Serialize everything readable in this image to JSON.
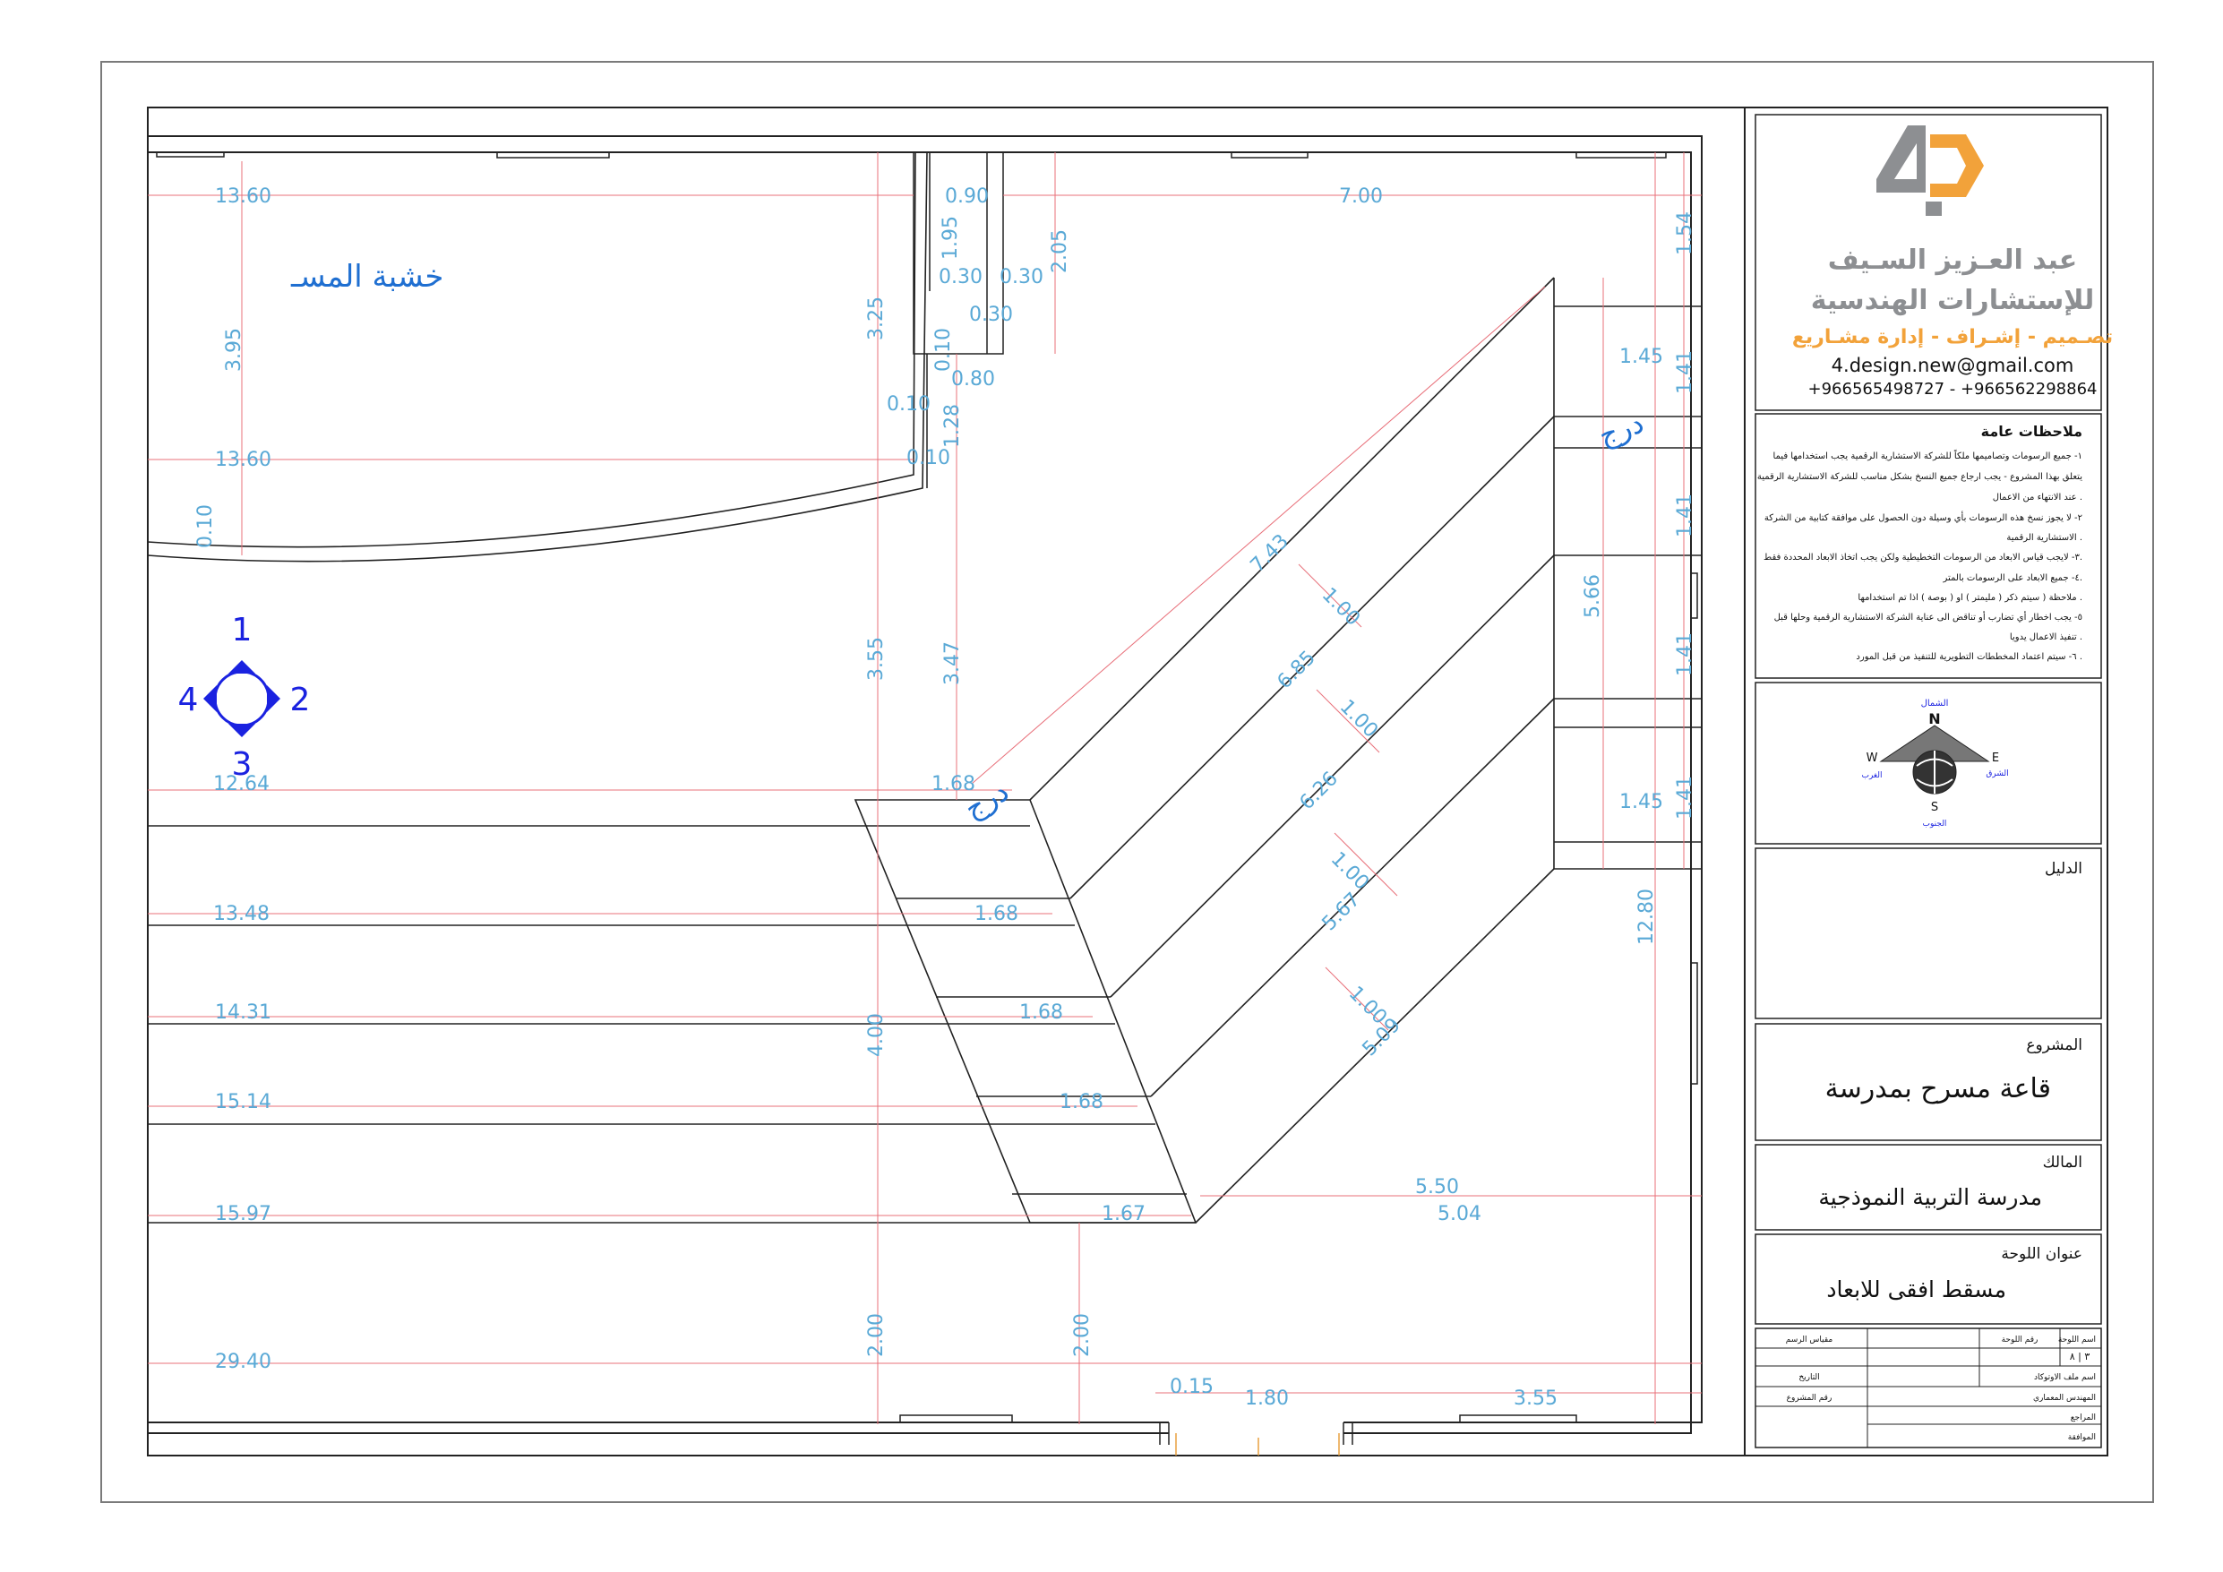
{
  "title_block": {
    "company_name_line1": "عبد العـزيز السـيف",
    "company_name_line2": "للإستشارات الهندسية",
    "services": "تصـميم - إشـراف - إدارة مشـاريع",
    "email": "4.design.new@gmail.com",
    "phones": "+966565498727 - +966562298864",
    "notes_title": "ملاحظات عامة",
    "notes": [
      "١- جميع الرسومات وتصاميمها ملكاً للشركة الاستشارية الرقمية يجب استخدامها فيما",
      "يتعلق بهذا المشروع - يجب ارجاع جميع النسخ بشكل مناسب للشركة الاستشارية الرقمية",
      "عند الانتهاء من الاعمال .",
      "٢- لا يجوز نسخ هذه الرسومات بأي وسيلة دون الحصول على موافقة كتابية من الشركة",
      "الاستشارية الرقمية .",
      "٣- لايجب قياس الابعاد من الرسومات التخطيطية ولكن يجب اتخاذ الابعاد المحددة فقط.",
      "٤- جميع الابعاد على الرسومات بالمتر.",
      "ملاحظة ( سيتم ذكر ( مليمتر ) او ( بوصة ) اذا تم استخدامها .",
      "٥- يجب اخطار أي تضارب أو تناقض الى عناية الشركة الاستشارية الرقمية وحلها قبل",
      "تنفيذ الاعمال يدويا .",
      "٦- سيتم اعتماد المخططات التطويرية للتنفيذ من قبل المورد ."
    ],
    "compass": {
      "north": "N",
      "south": "S",
      "east": "E",
      "west": "W",
      "north_ar": "الشمال",
      "south_ar": "الجنوب",
      "east_ar": "الشرق",
      "west_ar": "الغرب"
    },
    "legend_label": "الدليل",
    "project_label": "المشروع",
    "project_name": "قاعة مسرح بمدرسة",
    "owner_label": "المالك",
    "owner_name": "مدرسة التربية النموذجية",
    "sheet_title_label": "عنوان اللوحة",
    "sheet_title": "مسقط افقى للابعاد",
    "grid": {
      "scale_label": "مقياس الرسم",
      "sheet_no_label": "رقم اللوحة",
      "sheet_name_label": "اسم اللوحة",
      "sheet_code": "٣ | ٨",
      "date_label": "التاريخ",
      "designer_label": "اسم ملف الاوتوكاد",
      "project_no_label": "رقم المشروع",
      "architect_label": "المهندس المعماري",
      "review_label": "المراجع",
      "approval_label": "الموافقة"
    }
  },
  "drawing": {
    "stage_label": "خشبة المسـ",
    "stairs_label": "درج",
    "stairs_label_2": "درج",
    "elevation_marker": {
      "top": "1",
      "right": "2",
      "bottom": "3",
      "left": "4"
    },
    "dimensions": {
      "d_13_60_a": "13.60",
      "d_0_90": "0.90",
      "d_7_00": "7.00",
      "d_1_54": "1.54",
      "d_1_95": "1.95",
      "d_0_30_a": "0.30",
      "d_0_30_b": "0.30",
      "d_2_05": "2.05",
      "d_0_30_c": "0.30",
      "d_3_25": "3.25",
      "d_3_95": "3.95",
      "d_0_10_a": "0.10",
      "d_0_80": "0.80",
      "d_1_45_a": "1.45",
      "d_1_41_a": "1.41",
      "d_0_10_b": "0.10",
      "d_1_28": "1.28",
      "d_13_60_b": "13.60",
      "d_0_10_c": "0.10",
      "d_0_10_d": "0.10",
      "d_7_43": "7.43",
      "d_1_00_a": "1.00",
      "d_1_41_b": "1.41",
      "d_5_66": "5.66",
      "d_6_85": "6.85",
      "d_3_55_a": "3.55",
      "d_3_47": "3.47",
      "d_1_41_c": "1.41",
      "d_1_00_b": "1.00",
      "d_6_26": "6.26",
      "d_12_64": "12.64",
      "d_1_68_a": "1.68",
      "d_1_45_b": "1.45",
      "d_1_41_d": "1.41",
      "d_1_00_c": "1.00",
      "d_5_67": "5.67",
      "d_13_48": "13.48",
      "d_1_68_b": "1.68",
      "d_12_80": "12.80",
      "d_1_00_d": "1.00",
      "d_14_31": "14.31",
      "d_1_68_c": "1.68",
      "d_5_09": "5.09",
      "d_4_00": "4.00",
      "d_15_14": "15.14",
      "d_1_68_d": "1.68",
      "d_5_50": "5.50",
      "d_15_97": "15.97",
      "d_1_67": "1.67",
      "d_5_04": "5.04",
      "d_2_00_a": "2.00",
      "d_2_00_b": "2.00",
      "d_29_40": "29.40",
      "d_0_15": "0.15",
      "d_1_80": "1.80",
      "d_3_55_b": "3.55"
    }
  },
  "colors": {
    "dimension": "#5aa9d6",
    "dimension_line": "#e8707a",
    "label": "#1f6fd1",
    "marker": "#1a22e0",
    "logo_grey": "#8d8f92",
    "logo_orange": "#f2a23a"
  }
}
